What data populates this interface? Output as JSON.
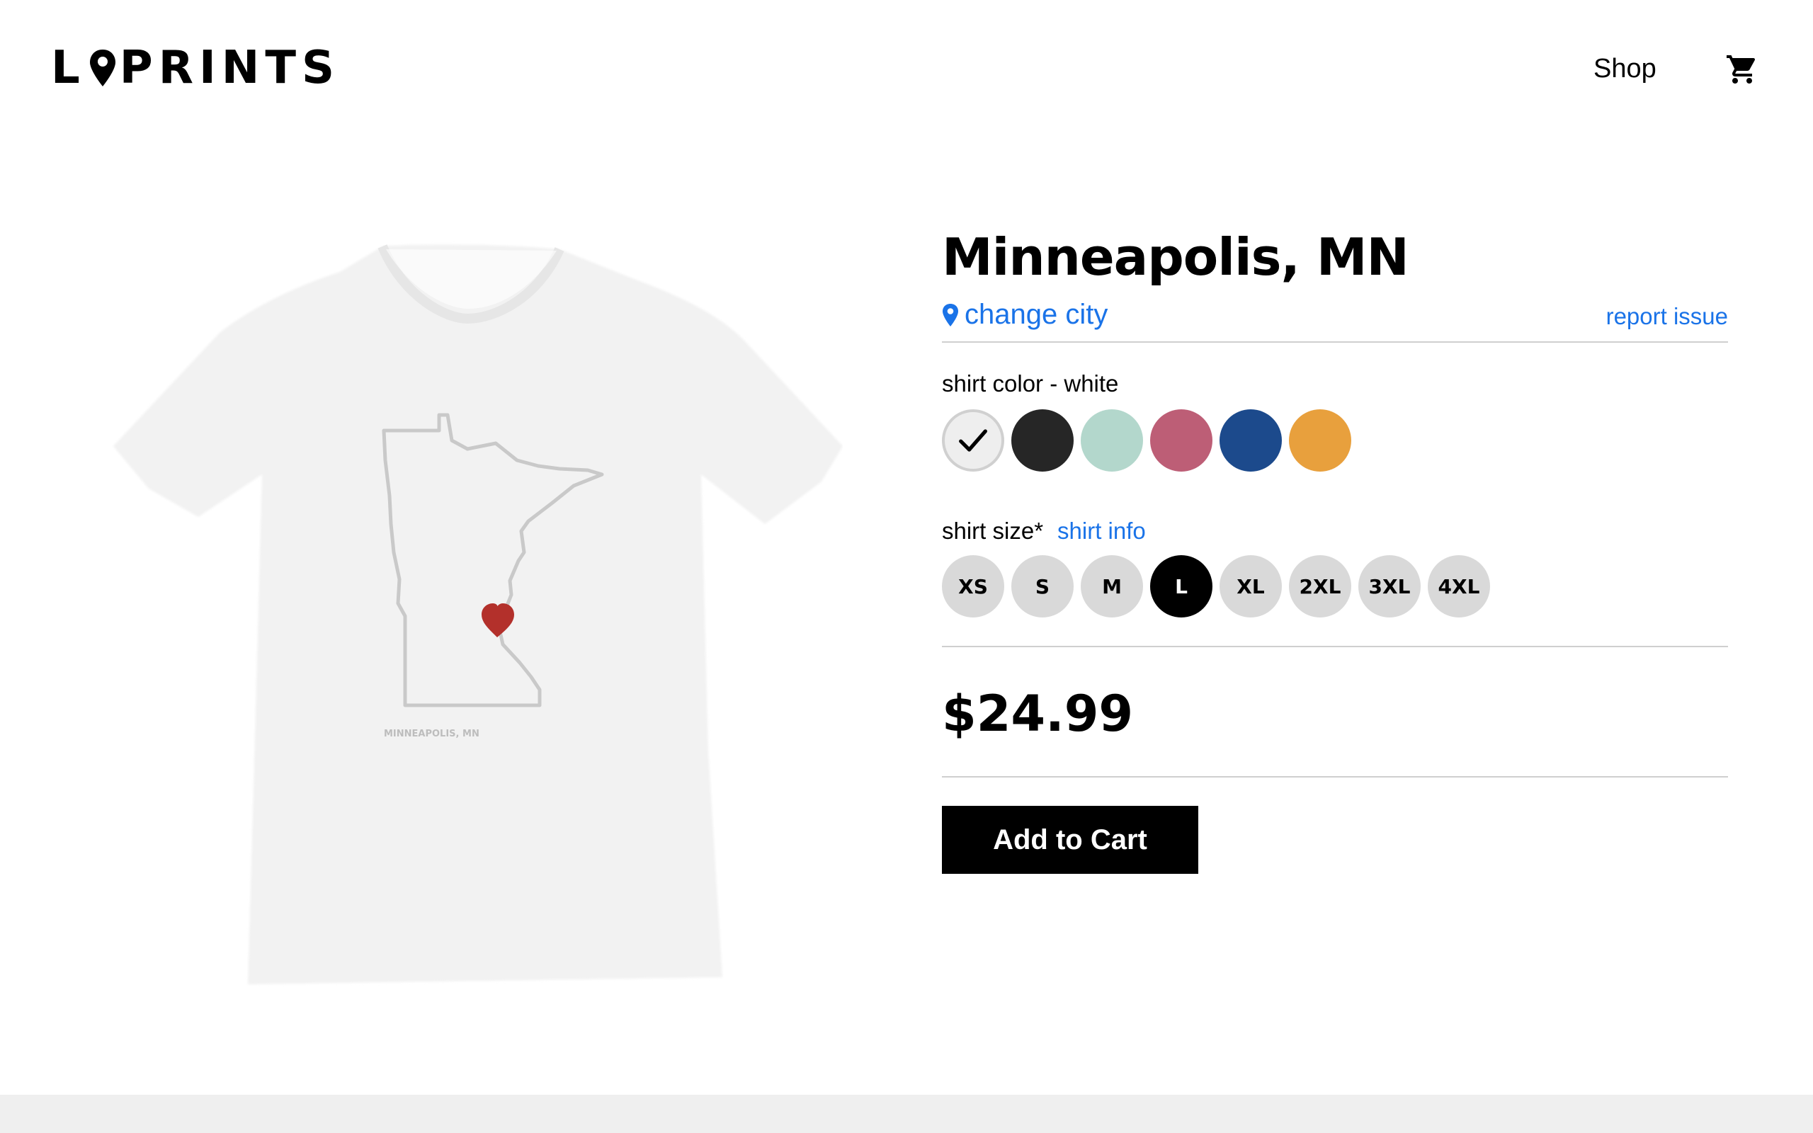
{
  "brand": {
    "logo_pre": "L",
    "logo_post": "PRINTS"
  },
  "nav": {
    "shop_label": "Shop",
    "cart_icon": "cart-icon"
  },
  "product": {
    "title": "Minneapolis, MN",
    "change_city_label": "change city",
    "report_issue_label": "report issue",
    "shirt_print_caption": "MINNEAPOLIS, MN",
    "color_label": "shirt color - white",
    "colors": [
      {
        "name": "white",
        "hex": "#eeeeee",
        "selected": true
      },
      {
        "name": "black",
        "hex": "#262626",
        "selected": false
      },
      {
        "name": "mint",
        "hex": "#b3d7cc",
        "selected": false
      },
      {
        "name": "rose",
        "hex": "#bd5e76",
        "selected": false
      },
      {
        "name": "royal blue",
        "hex": "#1c4a8c",
        "selected": false
      },
      {
        "name": "gold",
        "hex": "#e8a03d",
        "selected": false
      }
    ],
    "size_label": "shirt size*",
    "size_info_label": "shirt info",
    "sizes": [
      {
        "label": "XS",
        "selected": false
      },
      {
        "label": "S",
        "selected": false
      },
      {
        "label": "M",
        "selected": false
      },
      {
        "label": "L",
        "selected": true
      },
      {
        "label": "XL",
        "selected": false
      },
      {
        "label": "2XL",
        "selected": false
      },
      {
        "label": "3XL",
        "selected": false
      },
      {
        "label": "4XL",
        "selected": false
      }
    ],
    "price": "$24.99",
    "add_to_cart_label": "Add to Cart"
  },
  "theme": {
    "link_color": "#1a73e8",
    "heart_color": "#b3302b"
  }
}
